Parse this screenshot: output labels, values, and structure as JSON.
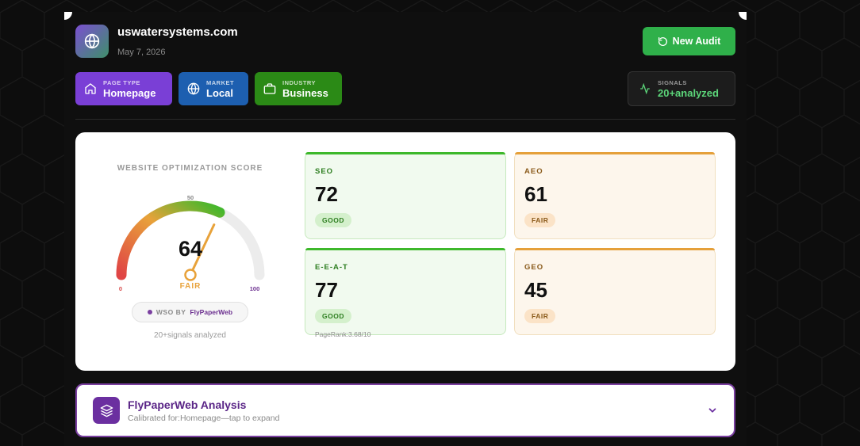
{
  "site": {
    "domain": "uswatersystems.com",
    "date": "May 7, 2026"
  },
  "actions": {
    "new_audit_label": "New Audit"
  },
  "chips": {
    "page_type": {
      "label": "PAGE TYPE",
      "value": "Homepage"
    },
    "market": {
      "label": "MARKET",
      "value": "Local"
    },
    "industry": {
      "label": "INDUSTRY",
      "value": "Business"
    }
  },
  "signals": {
    "label": "SIGNALS",
    "value": "20+analyzed"
  },
  "gauge": {
    "title": "WEBSITE OPTIMIZATION SCORE",
    "score": "64",
    "score_value": 64,
    "rating": "FAIR",
    "min_label": "0",
    "mid_label": "50",
    "max_label": "100"
  },
  "wso": {
    "prefix": "WSO BY",
    "brand": "FlyPaperWeb"
  },
  "signals_analyzed": "20+signals analyzed",
  "metrics": [
    {
      "name": "SEO",
      "value": "72",
      "badge": "GOOD",
      "status": "good"
    },
    {
      "name": "AEO",
      "value": "61",
      "badge": "FAIR",
      "status": "fair"
    },
    {
      "name": "E-E-A-T",
      "value": "77",
      "badge": "GOOD",
      "status": "good",
      "note": "PageRank:3.68/10"
    },
    {
      "name": "GEO",
      "value": "45",
      "badge": "FAIR",
      "status": "fair"
    }
  ],
  "analysis": {
    "title": "FlyPaperWeb Analysis",
    "subtitle": "Calibrated for:Homepage—tap to expand"
  },
  "colors": {
    "good": "#3db82b",
    "fair": "#e5a03a",
    "new_audit": "#2fb04a",
    "page_type_chip": "#7a3fd6",
    "market_chip": "#1d5fb0",
    "industry_chip": "#2b8a16",
    "brand_purple": "#6b2fa0"
  },
  "icons": {
    "site": "globe-icon",
    "new_audit": "refresh-icon",
    "page_type": "home-icon",
    "market": "globe-icon",
    "industry": "briefcase-icon",
    "signals": "activity-icon",
    "analysis": "layers-icon",
    "expand": "chevron-down-icon"
  }
}
